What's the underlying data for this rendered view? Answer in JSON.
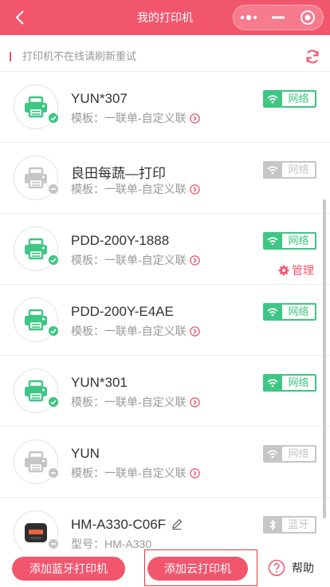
{
  "header": {
    "title": "我的打印机"
  },
  "notice": {
    "text": "打印机不在线请刷新重试"
  },
  "colors": {
    "accent": "#f2566d",
    "online": "#3ec683",
    "offline": "#c6c6c6"
  },
  "printers": [
    {
      "name": "YUN*307",
      "sub_label": "模板：",
      "sub_value": "一联单-自定义联",
      "status": "online",
      "connection": "网络",
      "connection_icon": "wifi-icon"
    },
    {
      "name": "良田每蔬—打印",
      "sub_label": "模板：",
      "sub_value": "一联单-自定义联",
      "status": "offline",
      "connection": "网络",
      "connection_icon": "wifi-icon"
    },
    {
      "name": "PDD-200Y-1888",
      "sub_label": "模板：",
      "sub_value": "一联单-自定义联",
      "status": "online",
      "connection": "网络",
      "connection_icon": "wifi-icon",
      "manage": "管理"
    },
    {
      "name": "PDD-200Y-E4AE",
      "sub_label": "模板：",
      "sub_value": "一联单-自定义联",
      "status": "online",
      "connection": "网络",
      "connection_icon": "wifi-icon"
    },
    {
      "name": "YUN*301",
      "sub_label": "模板：",
      "sub_value": "一联单-自定义联",
      "status": "online",
      "connection": "网络",
      "connection_icon": "wifi-icon"
    },
    {
      "name": "YUN",
      "sub_label": "模板：",
      "sub_value": "一联单-自定义联",
      "status": "offline",
      "connection": "网络",
      "connection_icon": "wifi-icon"
    },
    {
      "name": "HM-A330-C06F",
      "sub_label": "型号：",
      "sub_value": "HM-A330",
      "status": "offline",
      "connection": "蓝牙",
      "connection_icon": "bluetooth-icon",
      "editable": true,
      "device": "bluetooth"
    }
  ],
  "bottom": {
    "add_bluetooth": "添加蓝牙打印机",
    "add_cloud": "添加云打印机",
    "help": "帮助"
  }
}
